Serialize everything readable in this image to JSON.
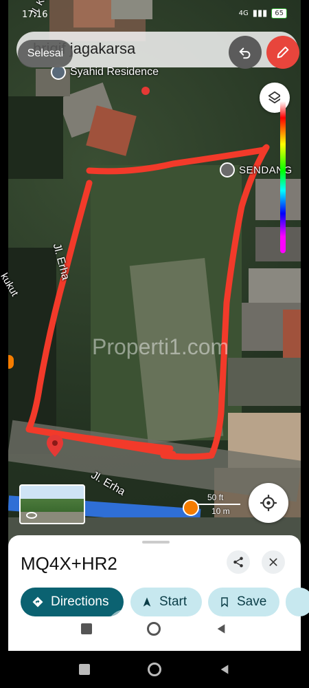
{
  "status": {
    "time": "17:16",
    "battery": "65",
    "network": "4G"
  },
  "search": {
    "query": "brigif jagakarsa"
  },
  "toolbar": {
    "done_label": "Selesai"
  },
  "map": {
    "labels": {
      "residence": "Syahid Residence",
      "sendang": "SENDANG",
      "street_top": "Jl. Erha",
      "street_bottom": "Jl. Erha",
      "left_partial": "kukut",
      "top_left_partial": "Jl. Kalmer",
      "watermark": "Properti1.com"
    },
    "scale": {
      "ft": "50 ft",
      "m": "10 m"
    },
    "outline_color": "#f23a2a"
  },
  "place": {
    "plus_code": "MQ4X+HR2",
    "directions_label": "Directions",
    "start_label": "Start",
    "save_label": "Save"
  },
  "colors": {
    "accent": "#0b6271",
    "chip": "#c7e8ef",
    "pen": "#e8453c"
  }
}
